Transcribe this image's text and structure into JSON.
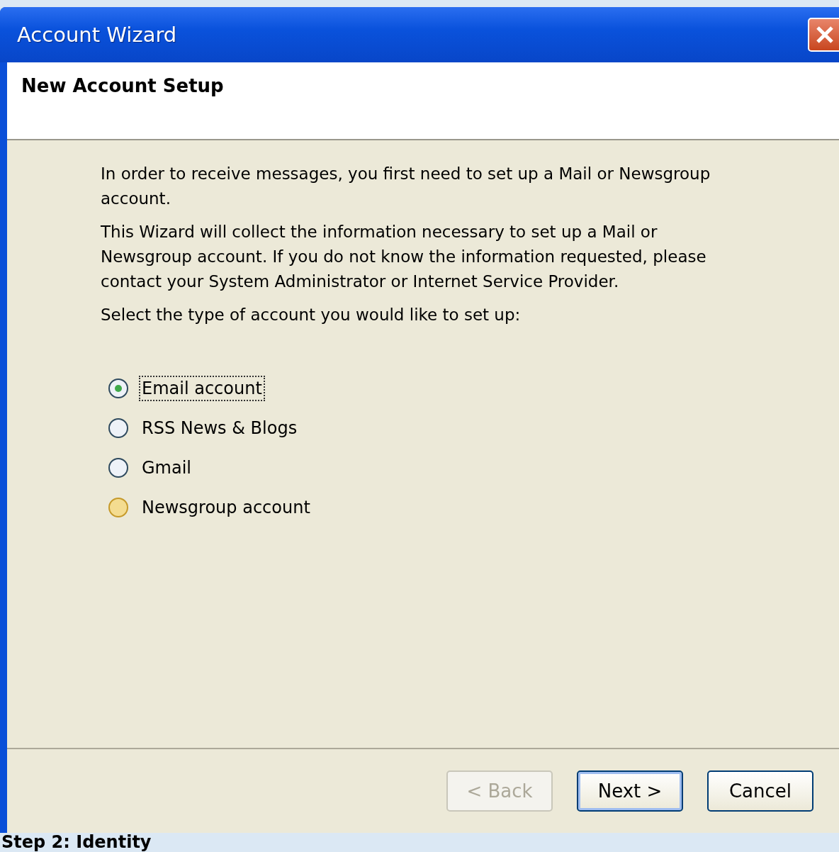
{
  "window": {
    "title": "Account Wizard"
  },
  "header": {
    "title": "New Account Setup"
  },
  "paragraphs": [
    "In order to receive messages, you first need to set up a Mail or Newsgroup account.",
    "This Wizard will collect the information necessary to set up a Mail or Newsgroup account. If you do not know the information requested, please contact your System Administrator or Internet Service Provider.",
    "Select the type of account you would like to set up:"
  ],
  "account_types": [
    {
      "label": "Email account",
      "selected": true,
      "focused": true,
      "hovered": false
    },
    {
      "label": "RSS News & Blogs",
      "selected": false,
      "focused": false,
      "hovered": false
    },
    {
      "label": "Gmail",
      "selected": false,
      "focused": false,
      "hovered": false
    },
    {
      "label": "Newsgroup account",
      "selected": false,
      "focused": false,
      "hovered": true
    }
  ],
  "buttons": [
    {
      "label": "< Back",
      "disabled": true,
      "default": false
    },
    {
      "label": "Next >",
      "disabled": false,
      "default": true
    },
    {
      "label": "Cancel",
      "disabled": false,
      "default": false
    }
  ],
  "page_text": "Step 2: Identity"
}
